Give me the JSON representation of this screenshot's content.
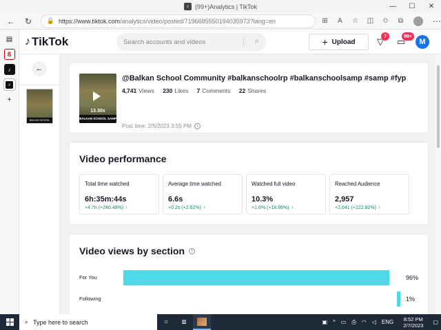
{
  "browser": {
    "tab_title": "(99+)Analytics | TikTok",
    "url_host": "https://www.tiktok.com",
    "url_path": "/analytics/video/posted/7196685550194035973?lang=en"
  },
  "tiktok": {
    "logo_text": "TikTok",
    "search_placeholder": "Search accounts and videos",
    "upload_label": "Upload",
    "inbox_badge": "7",
    "messages_badge": "99+",
    "avatar_letter": "M"
  },
  "video": {
    "title": "@Balkan School Community #balkanschoolrp #balkanschoolsamp #samp #fyp",
    "views": "4,741",
    "views_label": "Views",
    "likes": "230",
    "likes_label": "Likes",
    "comments": "7",
    "comments_label": "Comments",
    "shares": "22",
    "shares_label": "Shares",
    "post_time": "Post time: 2/5/2023 3:55 PM",
    "thumb_duration": "13.30s",
    "thumb_caption": "BALKAN SCHOOL SAMP"
  },
  "performance": {
    "title": "Video performance",
    "metrics": [
      {
        "label": "Total time watched",
        "value": "6h:35m:44s",
        "change": "+4.7h (+240.48%)"
      },
      {
        "label": "Average time watched",
        "value": "6.6s",
        "change": "+0.2s (+2.62%)"
      },
      {
        "label": "Watched full video",
        "value": "10.3%",
        "change": "+1.6% (+18.96%)"
      },
      {
        "label": "Reached Audience",
        "value": "2,957",
        "change": "+2,041 (+222.82%)"
      }
    ]
  },
  "sections": {
    "title": "Video views by section",
    "bar_color": "#4fd8e8"
  },
  "chart_data": {
    "type": "bar",
    "title": "Video views by section",
    "categories": [
      "For You",
      "Following"
    ],
    "values": [
      96,
      1
    ],
    "labels": [
      "96%",
      "1%"
    ],
    "unit": "%",
    "ylim": [
      0,
      100
    ]
  },
  "taskbar": {
    "search_placeholder": "Type here to search",
    "language": "ENG",
    "time": "8:52 PM",
    "date": "2/7/2023"
  }
}
